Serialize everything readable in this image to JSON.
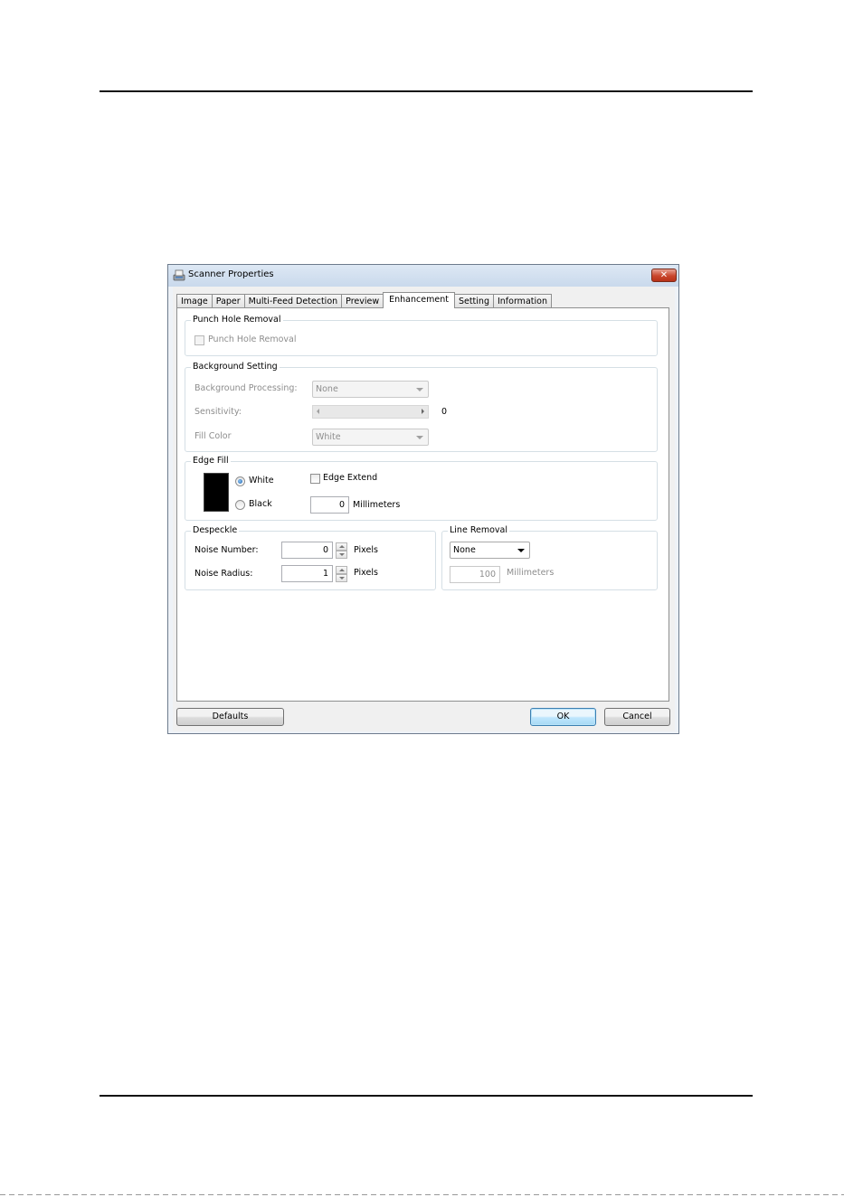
{
  "window": {
    "title": "Scanner Properties",
    "close_label": "✕"
  },
  "tabs": [
    {
      "label": "Image"
    },
    {
      "label": "Paper"
    },
    {
      "label": "Multi-Feed Detection"
    },
    {
      "label": "Preview"
    },
    {
      "label": "Enhancement",
      "active": true
    },
    {
      "label": "Setting"
    },
    {
      "label": "Information"
    }
  ],
  "punch_hole": {
    "group_title": "Punch Hole Removal",
    "checkbox_label": "Punch Hole Removal",
    "checked": false,
    "enabled": false
  },
  "background": {
    "group_title": "Background Setting",
    "processing_label": "Background Processing:",
    "processing_value": "None",
    "sensitivity_label": "Sensitivity:",
    "sensitivity_value": "0",
    "fill_color_label": "Fill Color",
    "fill_color_value": "White"
  },
  "edge_fill": {
    "group_title": "Edge Fill",
    "white_label": "White",
    "black_label": "Black",
    "selected": "White",
    "edge_extend_label": "Edge Extend",
    "edge_extend_checked": false,
    "mm_value": "0",
    "mm_unit": "Millimeters",
    "preview_color": "#000000"
  },
  "despeckle": {
    "group_title": "Despeckle",
    "noise_number_label": "Noise Number:",
    "noise_number_value": "0",
    "noise_number_unit": "Pixels",
    "noise_radius_label": "Noise Radius:",
    "noise_radius_value": "1",
    "noise_radius_unit": "Pixels"
  },
  "line_removal": {
    "group_title": "Line Removal",
    "mode_value": "None",
    "length_value": "100",
    "length_unit": "Millimeters"
  },
  "buttons": {
    "defaults": "Defaults",
    "ok": "OK",
    "cancel": "Cancel"
  }
}
